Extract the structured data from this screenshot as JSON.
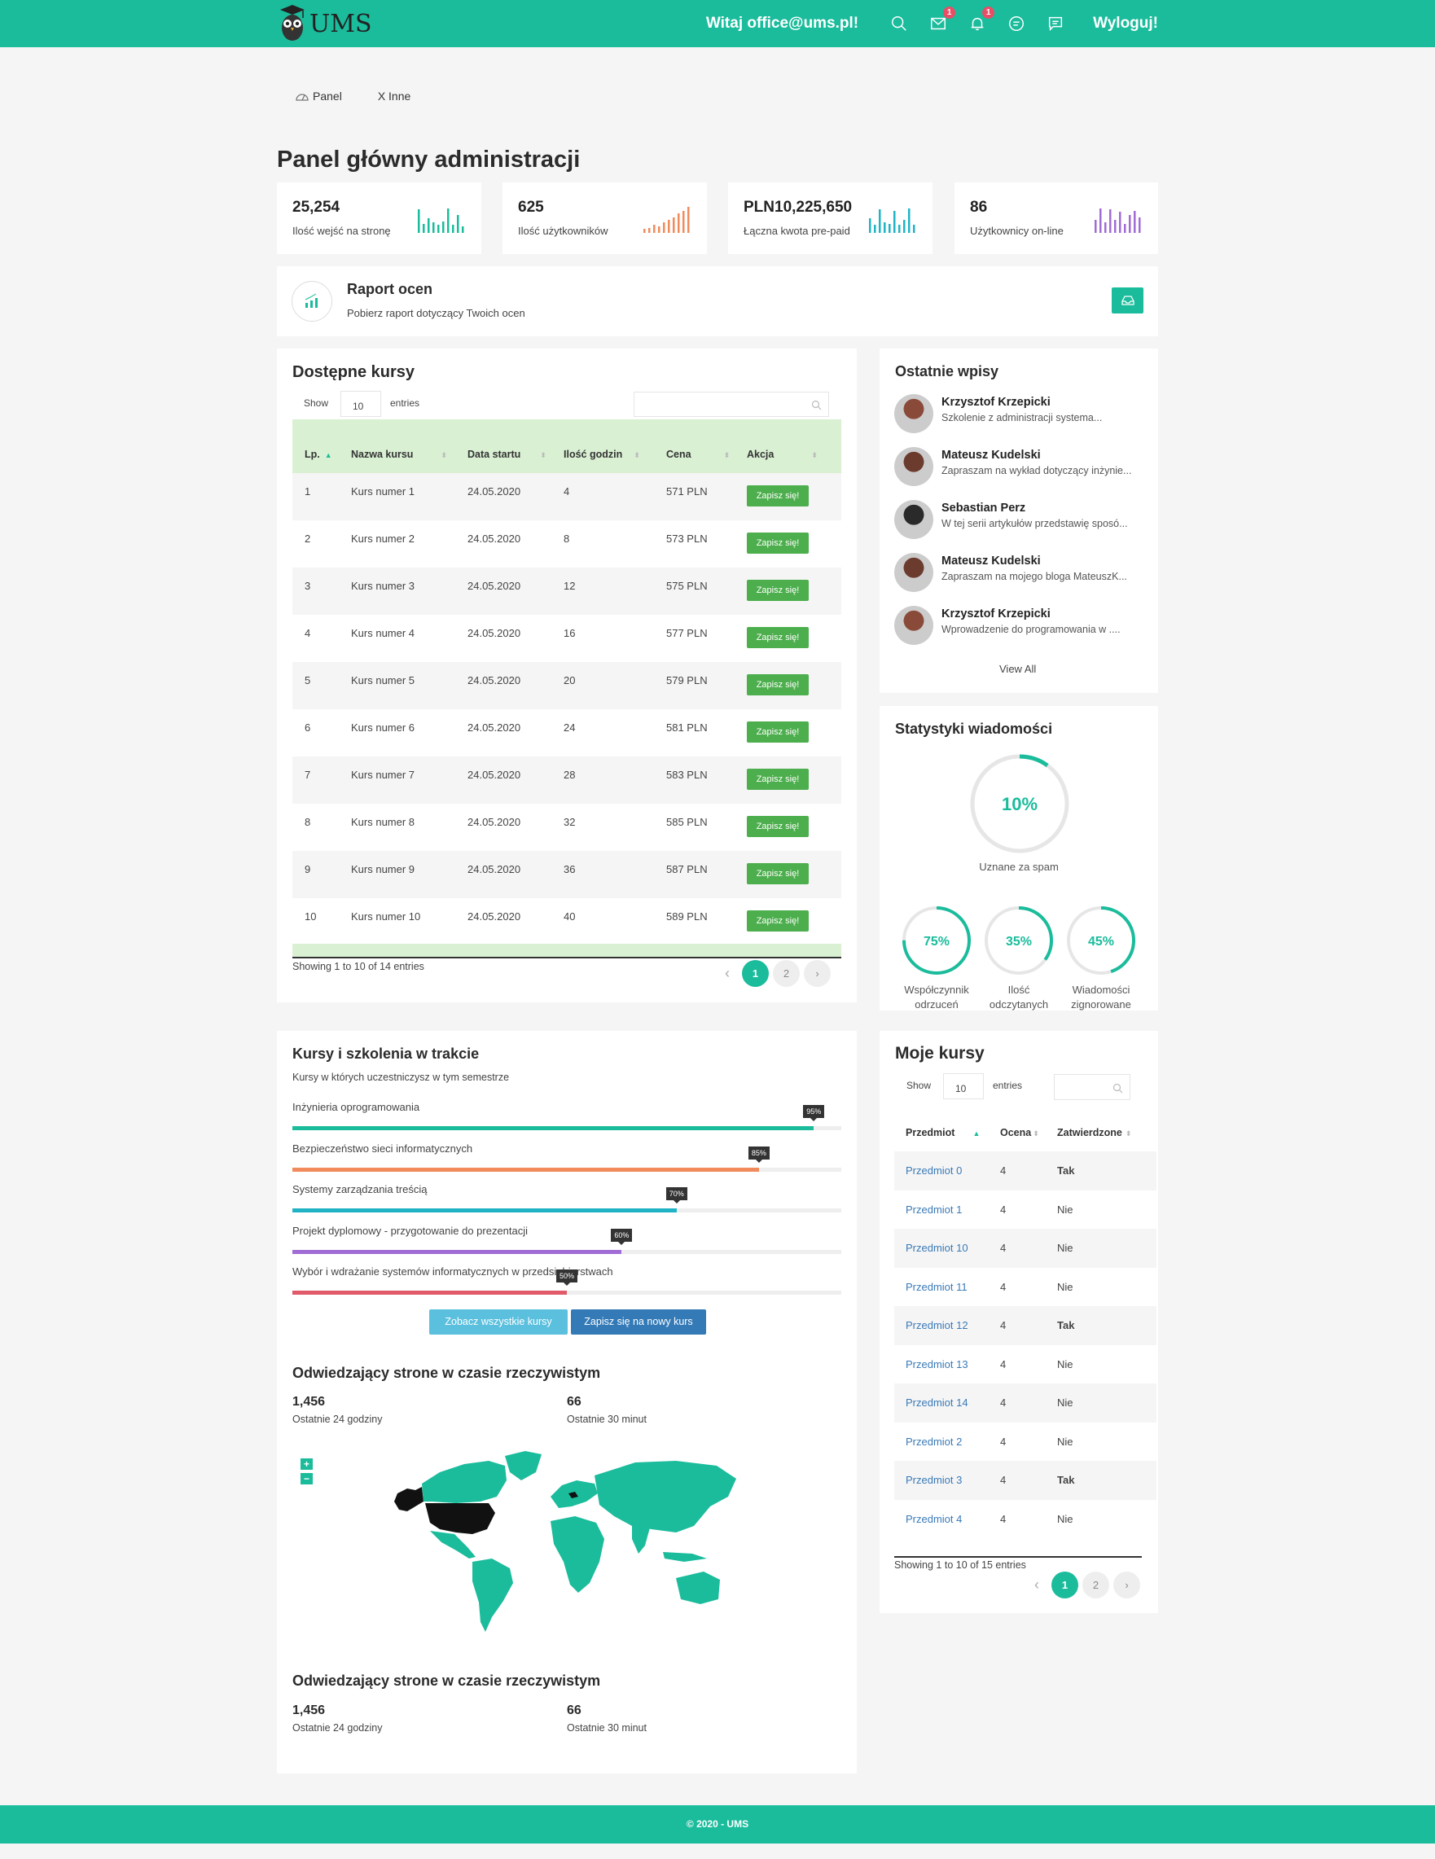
{
  "header": {
    "logo_text": "UMS",
    "welcome": "Witaj office@ums.pl!",
    "mail_badge": "1",
    "bell_badge": "1",
    "logout": "Wyloguj!"
  },
  "breadcrumb": {
    "panel": "Panel",
    "other": "X Inne"
  },
  "page_title": "Panel główny administracji",
  "stats": [
    {
      "value": "25,254",
      "label": "Ilość wejść na stronę",
      "color": "#1abc9c"
    },
    {
      "value": "625",
      "label": "Ilość użytkowników",
      "color": "#f28b5b"
    },
    {
      "value": "PLN10,225,650",
      "label": "Łączna kwota pre-paid",
      "color": "#20b3c6"
    },
    {
      "value": "86",
      "label": "Użytkownicy on-line",
      "color": "#a06cd5"
    }
  ],
  "report": {
    "title": "Raport ocen",
    "subtitle": "Pobierz raport dotyczący Twoich ocen"
  },
  "courses": {
    "title": "Dostępne kursy",
    "show": "Show",
    "entries_value": "10",
    "entries": "entries",
    "columns": [
      "Lp.",
      "Nazwa kursu",
      "Data startu",
      "Ilość godzin",
      "Cena",
      "Akcja"
    ],
    "action_label": "Zapisz się!",
    "rows": [
      [
        "1",
        "Kurs numer 1",
        "24.05.2020",
        "4",
        "571 PLN"
      ],
      [
        "2",
        "Kurs numer 2",
        "24.05.2020",
        "8",
        "573 PLN"
      ],
      [
        "3",
        "Kurs numer 3",
        "24.05.2020",
        "12",
        "575 PLN"
      ],
      [
        "4",
        "Kurs numer 4",
        "24.05.2020",
        "16",
        "577 PLN"
      ],
      [
        "5",
        "Kurs numer 5",
        "24.05.2020",
        "20",
        "579 PLN"
      ],
      [
        "6",
        "Kurs numer 6",
        "24.05.2020",
        "24",
        "581 PLN"
      ],
      [
        "7",
        "Kurs numer 7",
        "24.05.2020",
        "28",
        "583 PLN"
      ],
      [
        "8",
        "Kurs numer 8",
        "24.05.2020",
        "32",
        "585 PLN"
      ],
      [
        "9",
        "Kurs numer 9",
        "24.05.2020",
        "36",
        "587 PLN"
      ],
      [
        "10",
        "Kurs numer 10",
        "24.05.2020",
        "40",
        "589 PLN"
      ]
    ],
    "info": "Showing 1 to 10 of 14 entries",
    "pages": [
      "1",
      "2"
    ]
  },
  "recent": {
    "title": "Ostatnie wpisy",
    "items": [
      {
        "name": "Krzysztof Krzepicki",
        "text": "Szkolenie z administracji systema..."
      },
      {
        "name": "Mateusz Kudelski",
        "text": "Zapraszam na wykład dotyczący inżynie..."
      },
      {
        "name": "Sebastian Perz",
        "text": "W tej serii artykułów przedstawię sposó..."
      },
      {
        "name": "Mateusz Kudelski",
        "text": "Zapraszam na mojego bloga MateuszK..."
      },
      {
        "name": "Krzysztof Krzepicki",
        "text": "Wprowadzenie do programowania w ...."
      }
    ],
    "view_all": "View All"
  },
  "msg_stats": {
    "title": "Statystyki wiadomości",
    "main": {
      "value": "10%",
      "fraction": 0.1,
      "label": "Uznane za spam"
    },
    "small": [
      {
        "value": "75%",
        "fraction": 0.75,
        "label1": "Współczynnik",
        "label2": "odrzuceń"
      },
      {
        "value": "35%",
        "fraction": 0.35,
        "label1": "Ilość",
        "label2": "odczytanych"
      },
      {
        "value": "45%",
        "fraction": 0.45,
        "label1": "Wiadomości",
        "label2": "zignorowane"
      }
    ]
  },
  "training": {
    "title": "Kursy i szkolenia w trakcie",
    "subtitle": "Kursy w których uczestniczysz w tym semestrze",
    "items": [
      {
        "label": "Inżynieria oprogramowania",
        "percent": "95%",
        "value": 0.95,
        "color": "#1abc9c"
      },
      {
        "label": "Bezpieczeństwo sieci informatycznych",
        "percent": "85%",
        "value": 0.85,
        "color": "#f28b5b"
      },
      {
        "label": "Systemy zarządzania treścią",
        "percent": "70%",
        "value": 0.7,
        "color": "#20b3c6"
      },
      {
        "label": "Projekt dyplomowy - przygotowanie do prezentacji",
        "percent": "60%",
        "value": 0.6,
        "color": "#a06cd5"
      },
      {
        "label": "Wybór i wdrażanie systemów informatycznych w przedsiębiorstwach",
        "percent": "50%",
        "value": 0.5,
        "color": "#e05a6a"
      }
    ],
    "btn_all": "Zobacz wszystkie kursy",
    "btn_new": "Zapisz się na nowy kurs"
  },
  "visitors": {
    "title": "Odwiedzający strone w czasie rzeczywistym",
    "v24": "1,456",
    "l24": "Ostatnie 24 godziny",
    "v30": "66",
    "l30": "Ostatnie 30 minut",
    "zoom_in": "+",
    "zoom_out": "−"
  },
  "visitors2": {
    "title": "Odwiedzający strone w czasie rzeczywistym",
    "v24": "1,456",
    "l24": "Ostatnie 24 godziny",
    "v30": "66",
    "l30": "Ostatnie 30 minut"
  },
  "my_courses": {
    "title": "Moje kursy",
    "show": "Show",
    "entries_value": "10",
    "entries": "entries",
    "columns": [
      "Przedmiot",
      "Ocena",
      "Zatwierdzone"
    ],
    "rows": [
      [
        "Przedmiot 0",
        "4",
        "Tak"
      ],
      [
        "Przedmiot 1",
        "4",
        "Nie"
      ],
      [
        "Przedmiot 10",
        "4",
        "Nie"
      ],
      [
        "Przedmiot 11",
        "4",
        "Nie"
      ],
      [
        "Przedmiot 12",
        "4",
        "Tak"
      ],
      [
        "Przedmiot 13",
        "4",
        "Nie"
      ],
      [
        "Przedmiot 14",
        "4",
        "Nie"
      ],
      [
        "Przedmiot 2",
        "4",
        "Nie"
      ],
      [
        "Przedmiot 3",
        "4",
        "Tak"
      ],
      [
        "Przedmiot 4",
        "4",
        "Nie"
      ]
    ],
    "info": "Showing 1 to 10 of 15 entries",
    "pages": [
      "1",
      "2"
    ]
  },
  "footer": "© 2020 - UMS"
}
